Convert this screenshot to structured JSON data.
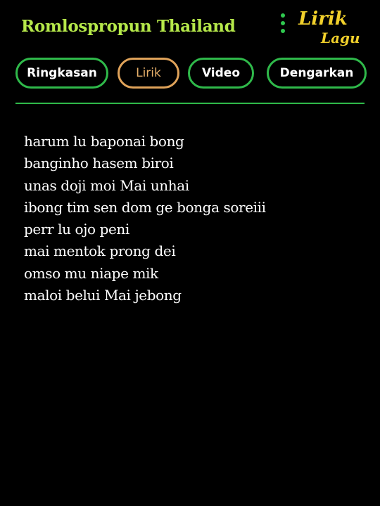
{
  "header": {
    "title": "Romlospropun Thailand",
    "menu_icon": "vertical-dots-icon",
    "logo": {
      "line1": "Lirik",
      "line2": "Lagu"
    }
  },
  "tabs": [
    {
      "label": "Ringkasan",
      "active": false
    },
    {
      "label": "Lirik",
      "active": true
    },
    {
      "label": "Video",
      "active": false
    },
    {
      "label": "Dengarkan",
      "active": false
    }
  ],
  "lyrics": [
    "harum lu baponai bong",
    "banginho hasem biroi",
    "unas doji moi Mai unhai",
    "ibong tim sen dom ge bonga soreiii",
    "perr lu ojo peni",
    "mai mentok prong dei",
    "omso mu niape mik",
    "maloi belui Mai jebong"
  ],
  "colors": {
    "background": "#000000",
    "title": "#b5e84a",
    "accent_green": "#2fb94a",
    "active_tab": "#e0a35a",
    "logo": "#f1d02b",
    "text": "#ffffff"
  }
}
